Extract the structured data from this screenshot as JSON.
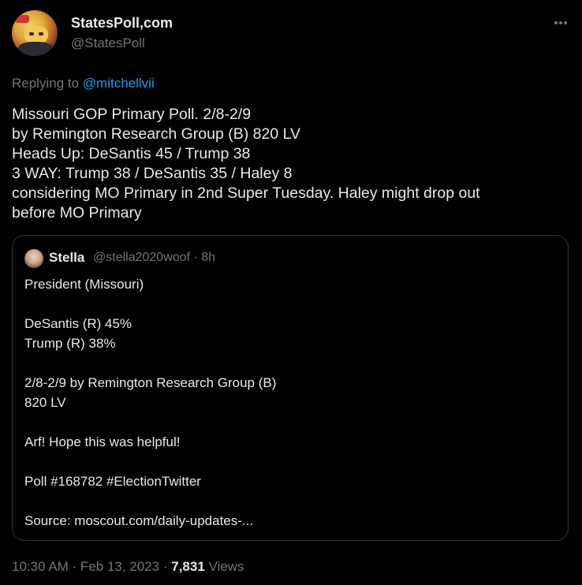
{
  "author": {
    "display_name": "StatesPoll,com",
    "handle": "@StatesPoll"
  },
  "menu_icon": "more-horizontal-icon",
  "reply": {
    "prefix": "Replying to ",
    "mention": "@mitchellvii"
  },
  "tweet": {
    "lines": [
      "Missouri GOP Primary Poll. 2/8-2/9",
      "by Remington Research Group (B) 820 LV",
      "Heads Up: DeSantis 45 / Trump 38",
      "3 WAY: Trump 38 / DeSantis 35 / Haley 8",
      "considering MO Primary in 2nd Super Tuesday. Haley might drop out",
      "before MO Primary"
    ]
  },
  "quote": {
    "name": "Stella",
    "meta": "@stella2020woof · 8h",
    "lines": [
      "President (Missouri)",
      "",
      "DeSantis (R) 45%",
      "Trump (R) 38%",
      "",
      "2/8-2/9 by Remington Research Group (B)",
      "820 LV",
      "",
      "Arf! Hope this was helpful!",
      "",
      "Poll #168782 #ElectionTwitter",
      "",
      "Source: moscout.com/daily-updates-..."
    ]
  },
  "footer": {
    "timestamp": "10:30 AM · Feb 13, 2023 · ",
    "views_count": "7,831",
    "views_label": " Views"
  },
  "colors": {
    "background": "#000000",
    "text": "#e7e9ea",
    "muted": "#71767b",
    "link": "#1d9bf0",
    "border": "#2f3336"
  }
}
